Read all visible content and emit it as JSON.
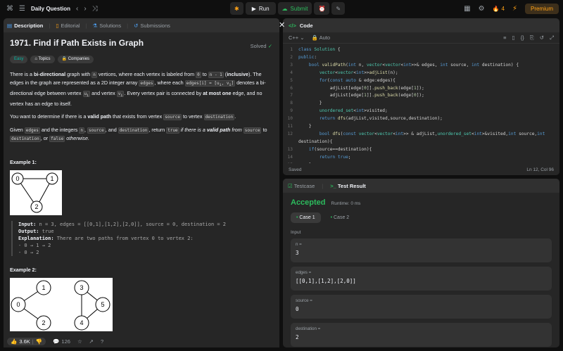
{
  "topbar": {
    "title": "Daily Question",
    "run_label": "Run",
    "submit_label": "Submit",
    "streak": "4",
    "premium_label": "Premium"
  },
  "left_tabs": [
    {
      "label": "Description"
    },
    {
      "label": "Editorial"
    },
    {
      "label": "Solutions"
    },
    {
      "label": "Submissions"
    }
  ],
  "problem": {
    "title": "1971. Find if Path Exists in Graph",
    "solved": "Solved",
    "difficulty": "Easy",
    "topics": "Topics",
    "companies": "Companies",
    "p1": [
      "There is a ",
      "bi-directional",
      " graph with ",
      "n",
      " vertices, where each vertex is labeled from ",
      "0",
      " to ",
      "n - 1",
      " (",
      "inclusive",
      "). The edges in the graph are represented as a 2D integer array ",
      "edges",
      ", where each ",
      "edges[i] = [u",
      "i",
      ", v",
      "i",
      "]",
      " denotes a bi-directional edge between vertex ",
      "u",
      "i",
      " and vertex ",
      "v",
      "i",
      ". Every vertex pair is connected by ",
      "at most one",
      " edge, and no vertex has an edge to itself."
    ],
    "p2": [
      "You want to determine if there is a ",
      "valid path",
      " that exists from vertex ",
      "source",
      " to vertex ",
      "destination",
      "."
    ],
    "p3": [
      "Given ",
      "edges",
      " and the integers ",
      "n",
      ", ",
      "source",
      ", and ",
      "destination",
      ", return ",
      "true",
      " if there is a ",
      "valid path",
      " from ",
      "source",
      " to ",
      "destination",
      ", or ",
      "false",
      " otherwise."
    ],
    "example1_title": "Example 1:",
    "example1_nodes": [
      "0",
      "1",
      "2"
    ],
    "example1": {
      "input_label": "Input:",
      "input": "n = 3, edges = [[0,1],[1,2],[2,0]], source = 0, destination = 2",
      "output_label": "Output:",
      "output": "true",
      "expl_label": "Explanation:",
      "expl": "There are two paths from vertex 0 to vertex 2:",
      "line1": "- 0 → 1 → 2",
      "line2": "- 0 → 2"
    },
    "example2_title": "Example 2:",
    "example2_nodes": [
      "0",
      "1",
      "2",
      "3",
      "4",
      "5"
    ]
  },
  "footer": {
    "likes": "3.6K",
    "comments": "126"
  },
  "code": {
    "title": "Code",
    "language": "C++",
    "mode": "Auto",
    "saved": "Saved",
    "position": "Ln 12, Col 96",
    "lines": [
      {
        "n": "1",
        "tokens": [
          [
            "kw",
            "class "
          ],
          [
            "ty",
            "Solution "
          ],
          [
            "tx",
            "{"
          ]
        ]
      },
      {
        "n": "2",
        "tokens": [
          [
            "kw",
            "public"
          ],
          [
            "tx",
            ":"
          ]
        ]
      },
      {
        "n": "3",
        "tokens": [
          [
            "tx",
            "    "
          ],
          [
            "kw",
            "bool "
          ],
          [
            "fn",
            "validPath"
          ],
          [
            "tx",
            "("
          ],
          [
            "kw",
            "int "
          ],
          [
            "tx",
            "n, "
          ],
          [
            "ty",
            "vector"
          ],
          [
            "tx",
            "<"
          ],
          [
            "ty",
            "vector"
          ],
          [
            "tx",
            "<"
          ],
          [
            "kw",
            "int"
          ],
          [
            "tx",
            ">>& edges, "
          ],
          [
            "kw",
            "int "
          ],
          [
            "tx",
            "source, "
          ],
          [
            "kw",
            "int "
          ],
          [
            "tx",
            "destination) {"
          ]
        ]
      },
      {
        "n": "4",
        "tokens": [
          [
            "tx",
            "        "
          ],
          [
            "ty",
            "vector"
          ],
          [
            "tx",
            "<"
          ],
          [
            "ty",
            "vector"
          ],
          [
            "tx",
            "<"
          ],
          [
            "kw",
            "int"
          ],
          [
            "tx",
            ">>"
          ],
          [
            "fn",
            "adjList"
          ],
          [
            "tx",
            "(n);"
          ]
        ]
      },
      {
        "n": "5",
        "tokens": [
          [
            "tx",
            "        "
          ],
          [
            "kw",
            "for"
          ],
          [
            "tx",
            "("
          ],
          [
            "kw",
            "const auto "
          ],
          [
            "tx",
            "& edge:edges){"
          ]
        ]
      },
      {
        "n": "6",
        "tokens": [
          [
            "tx",
            "            adjList[edge["
          ],
          [
            "nm",
            "0"
          ],
          [
            "tx",
            "]]."
          ],
          [
            "fn",
            "push_back"
          ],
          [
            "tx",
            "(edge["
          ],
          [
            "nm",
            "1"
          ],
          [
            "tx",
            "]);"
          ]
        ]
      },
      {
        "n": "7",
        "tokens": [
          [
            "tx",
            "            adjList[edge["
          ],
          [
            "nm",
            "1"
          ],
          [
            "tx",
            "]]."
          ],
          [
            "fn",
            "push_back"
          ],
          [
            "tx",
            "(edge["
          ],
          [
            "nm",
            "0"
          ],
          [
            "tx",
            "]);"
          ]
        ]
      },
      {
        "n": "8",
        "tokens": [
          [
            "tx",
            "        }"
          ]
        ]
      },
      {
        "n": "9",
        "tokens": [
          [
            "tx",
            "        "
          ],
          [
            "ty",
            "unordered_set"
          ],
          [
            "tx",
            "<"
          ],
          [
            "kw",
            "int"
          ],
          [
            "tx",
            ">visited;"
          ]
        ]
      },
      {
        "n": "10",
        "tokens": [
          [
            "tx",
            "        "
          ],
          [
            "kw",
            "return "
          ],
          [
            "fn",
            "dfs"
          ],
          [
            "tx",
            "(adjList,visited,source,destination);"
          ]
        ]
      },
      {
        "n": "11",
        "tokens": [
          [
            "tx",
            "    }"
          ]
        ]
      },
      {
        "n": "12",
        "tokens": [
          [
            "tx",
            "        "
          ],
          [
            "kw",
            "bool "
          ],
          [
            "fn",
            "dfs"
          ],
          [
            "tx",
            "("
          ],
          [
            "kw",
            "const "
          ],
          [
            "ty",
            "vector"
          ],
          [
            "tx",
            "<"
          ],
          [
            "ty",
            "vector"
          ],
          [
            "tx",
            "<"
          ],
          [
            "kw",
            "int"
          ],
          [
            "tx",
            ">> & adjList,"
          ],
          [
            "ty",
            "unordered_set"
          ],
          [
            "tx",
            "<"
          ],
          [
            "kw",
            "int"
          ],
          [
            "tx",
            ">&visited,"
          ],
          [
            "kw",
            "int "
          ],
          [
            "tx",
            "source,"
          ],
          [
            "kw",
            "int"
          ]
        ]
      },
      {
        "n": "",
        "tokens": [
          [
            "tx",
            "destination){"
          ]
        ]
      },
      {
        "n": "13",
        "tokens": [
          [
            "tx",
            "    "
          ],
          [
            "kw",
            "if"
          ],
          [
            "tx",
            "(source==destination){"
          ]
        ]
      },
      {
        "n": "14",
        "tokens": [
          [
            "tx",
            "        "
          ],
          [
            "kw",
            "return "
          ],
          [
            "kw",
            "true"
          ],
          [
            "tx",
            ";"
          ]
        ]
      },
      {
        "n": "15",
        "tokens": [
          [
            "tx",
            "    }"
          ]
        ]
      },
      {
        "n": "16",
        "tokens": [
          [
            "tx",
            "    visited."
          ],
          [
            "fn",
            "insert"
          ],
          [
            "tx",
            "(source);"
          ]
        ]
      }
    ]
  },
  "testresult": {
    "tab_testcase": "Testcase",
    "tab_result": "Test Result",
    "status": "Accepted",
    "runtime": "Runtime: 0 ms",
    "case1": "Case 1",
    "case2": "Case 2",
    "input_label": "Input",
    "inputs": [
      {
        "k": "n =",
        "v": "3"
      },
      {
        "k": "edges =",
        "v": "[[0,1],[1,2],[2,0]]"
      },
      {
        "k": "source =",
        "v": "0"
      },
      {
        "k": "destination =",
        "v": "2"
      }
    ]
  }
}
